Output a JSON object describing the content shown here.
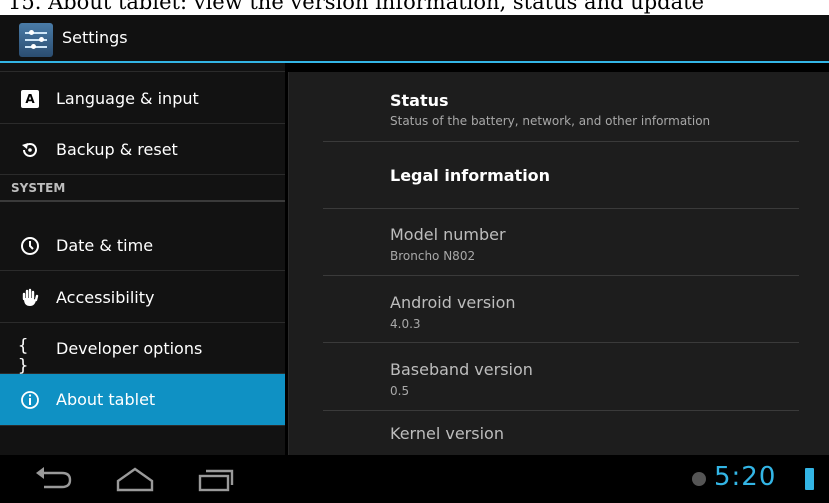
{
  "caption": "15. About tablet: view the version information, status and update",
  "action_bar": {
    "title": "Settings"
  },
  "left_pane": {
    "items_top": [
      {
        "label": "Language & input",
        "icon": "language-icon"
      },
      {
        "label": "Backup & reset",
        "icon": "backup-reset-icon"
      }
    ],
    "section_header": "SYSTEM",
    "items_system": [
      {
        "label": "Date & time",
        "icon": "clock-icon"
      },
      {
        "label": "Accessibility",
        "icon": "hand-icon"
      },
      {
        "label": "Developer options",
        "icon": "braces-icon"
      },
      {
        "label": "About tablet",
        "icon": "info-icon"
      }
    ],
    "selected": "About tablet"
  },
  "right_pane": {
    "items": [
      {
        "title": "Status",
        "subtitle": "Status of the battery, network, and other information"
      },
      {
        "title": "Legal information",
        "subtitle": ""
      },
      {
        "title": "Model number",
        "subtitle": "Broncho N802"
      },
      {
        "title": "Android version",
        "subtitle": "4.0.3"
      },
      {
        "title": "Baseband version",
        "subtitle": "0.5"
      },
      {
        "title": "Kernel version",
        "subtitle": ""
      }
    ]
  },
  "nav_bar": {
    "clock": "5:20"
  },
  "colors": {
    "accent": "#33b5e5",
    "selected": "#0f91c4"
  }
}
